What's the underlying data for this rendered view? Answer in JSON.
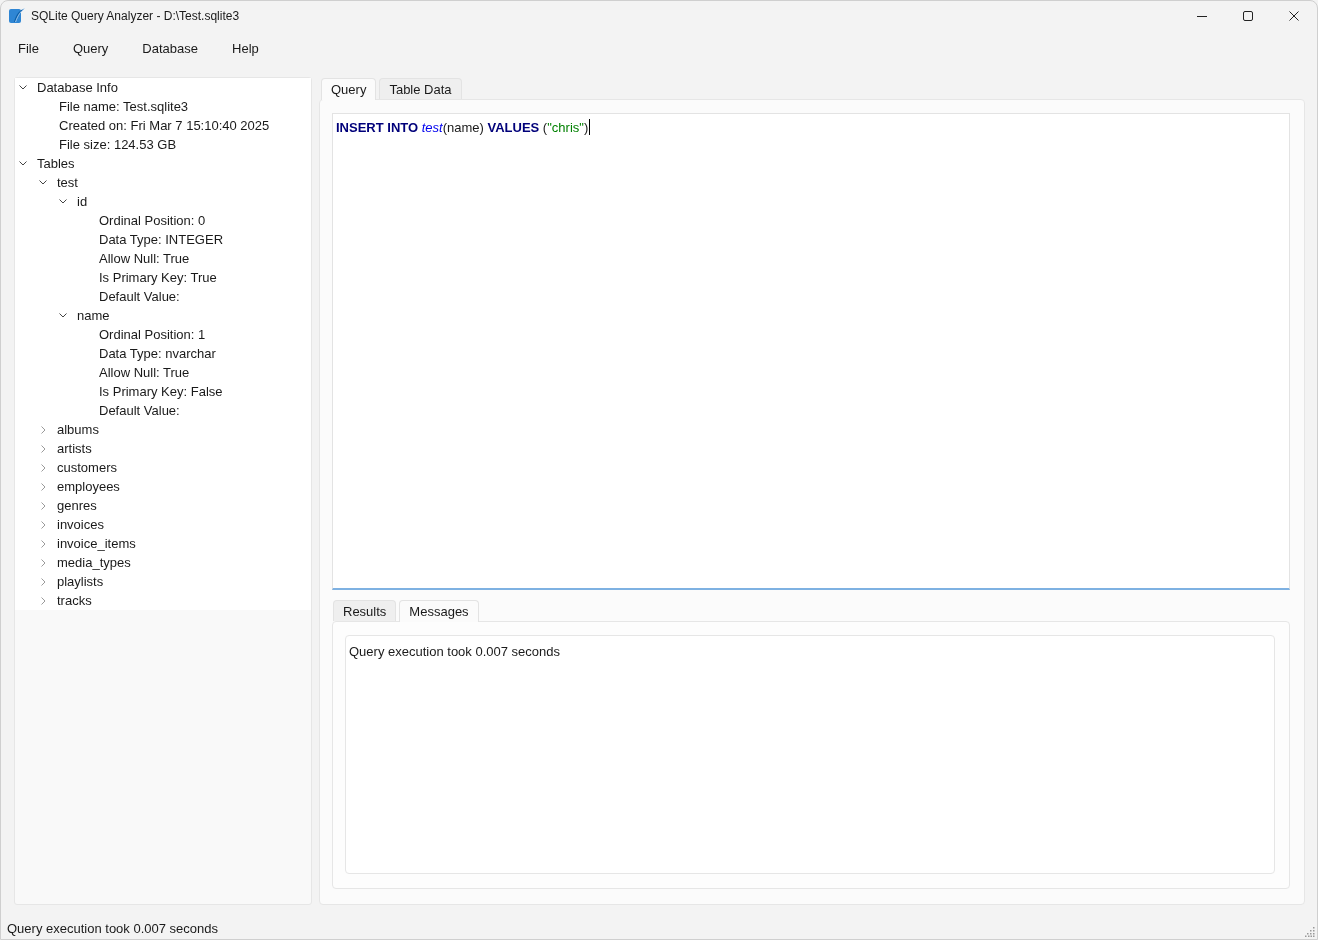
{
  "window": {
    "title": "SQLite Query Analyzer - D:\\Test.sqlite3"
  },
  "menu_bar": {
    "items": [
      "File",
      "Query",
      "Database",
      "Help"
    ]
  },
  "sidebar": {
    "tree": [
      {
        "label": "Database Info",
        "expanded": true,
        "children": [
          {
            "label": "File name: Test.sqlite3"
          },
          {
            "label": "Created on: Fri Mar 7 15:10:40 2025"
          },
          {
            "label": "File size: 124.53 GB"
          }
        ]
      },
      {
        "label": "Tables",
        "expanded": true,
        "children": [
          {
            "label": "test",
            "expanded": true,
            "children": [
              {
                "label": "id",
                "expanded": true,
                "children": [
                  {
                    "label": "Ordinal Position: 0"
                  },
                  {
                    "label": "Data Type: INTEGER"
                  },
                  {
                    "label": "Allow Null: True"
                  },
                  {
                    "label": "Is Primary Key: True"
                  },
                  {
                    "label": "Default Value:"
                  }
                ]
              },
              {
                "label": "name",
                "expanded": true,
                "children": [
                  {
                    "label": "Ordinal Position: 1"
                  },
                  {
                    "label": "Data Type: nvarchar"
                  },
                  {
                    "label": "Allow Null: True"
                  },
                  {
                    "label": "Is Primary Key: False"
                  },
                  {
                    "label": "Default Value:"
                  }
                ]
              }
            ]
          },
          {
            "label": "albums",
            "expanded": false
          },
          {
            "label": "artists",
            "expanded": false
          },
          {
            "label": "customers",
            "expanded": false
          },
          {
            "label": "employees",
            "expanded": false
          },
          {
            "label": "genres",
            "expanded": false
          },
          {
            "label": "invoices",
            "expanded": false
          },
          {
            "label": "invoice_items",
            "expanded": false
          },
          {
            "label": "media_types",
            "expanded": false
          },
          {
            "label": "playlists",
            "expanded": false
          },
          {
            "label": "tracks",
            "expanded": false
          }
        ]
      }
    ]
  },
  "editor_tabs": [
    {
      "label": "Query",
      "selected": true
    },
    {
      "label": "Table Data",
      "selected": false
    }
  ],
  "editor": {
    "tokens": [
      {
        "kind": "keyword",
        "text": "INSERT INTO "
      },
      {
        "kind": "identifier",
        "text": "test"
      },
      {
        "kind": "plain",
        "text": "(name) "
      },
      {
        "kind": "keyword",
        "text": "VALUES"
      },
      {
        "kind": "plain",
        "text": " ("
      },
      {
        "kind": "string",
        "text": "\"chris\""
      },
      {
        "kind": "plain",
        "text": ")"
      }
    ]
  },
  "result_tabs": [
    {
      "label": "Results",
      "selected": false
    },
    {
      "label": "Messages",
      "selected": true
    }
  ],
  "messages": {
    "text": "Query execution took 0.007 seconds"
  },
  "status_bar": {
    "text": "Query execution took 0.007 seconds"
  }
}
